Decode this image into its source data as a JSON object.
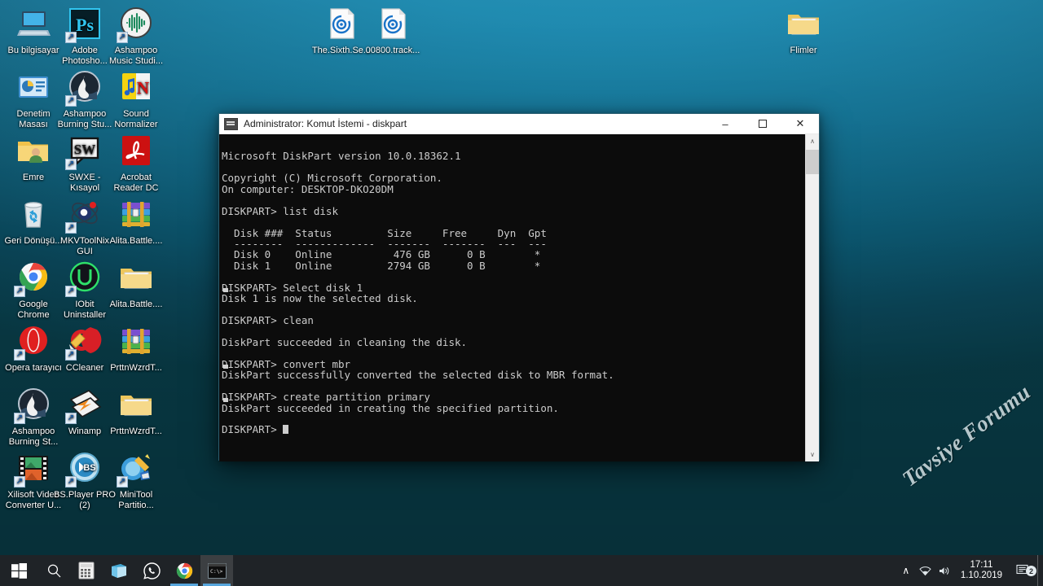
{
  "desktop": {
    "wallpaper_color_top": "#1b92b8",
    "wallpaper_color_bottom": "#083944",
    "watermark": "Tavsiye Forumu",
    "icons": [
      {
        "label": "Bu bilgisayar",
        "icon": "computer-icon",
        "shortcut": false,
        "col": 0,
        "row": 0
      },
      {
        "label": "Adobe Photosho...",
        "icon": "adobe-photoshop-icon",
        "shortcut": true,
        "col": 1,
        "row": 0
      },
      {
        "label": "Ashampoo Music Studi...",
        "icon": "ashampoo-music-studio-icon",
        "shortcut": true,
        "col": 2,
        "row": 0
      },
      {
        "label": "Denetim Masası",
        "icon": "control-panel-icon",
        "shortcut": false,
        "col": 0,
        "row": 1
      },
      {
        "label": "Ashampoo Burning Stu...",
        "icon": "ashampoo-burning-studio-icon",
        "shortcut": true,
        "col": 1,
        "row": 1
      },
      {
        "label": "Sound Normalizer",
        "icon": "sound-normalizer-icon",
        "shortcut": false,
        "col": 2,
        "row": 1
      },
      {
        "label": "Emre",
        "icon": "user-folder-icon",
        "shortcut": false,
        "col": 0,
        "row": 2
      },
      {
        "label": "SWXE - Kısayol",
        "icon": "swxe-icon",
        "shortcut": true,
        "col": 1,
        "row": 2
      },
      {
        "label": "Acrobat Reader DC",
        "icon": "acrobat-reader-icon",
        "shortcut": false,
        "col": 2,
        "row": 2
      },
      {
        "label": "Geri Dönüşü...",
        "icon": "recycle-bin-icon",
        "shortcut": false,
        "col": 0,
        "row": 3
      },
      {
        "label": "MKVToolNix GUI",
        "icon": "mkvtoolnix-icon",
        "shortcut": true,
        "col": 1,
        "row": 3
      },
      {
        "label": "Alita.Battle....",
        "icon": "winrar-archive-icon",
        "shortcut": false,
        "col": 2,
        "row": 3
      },
      {
        "label": "Google Chrome",
        "icon": "google-chrome-icon",
        "shortcut": true,
        "col": 0,
        "row": 4
      },
      {
        "label": "IObit Uninstaller",
        "icon": "iobit-uninstaller-icon",
        "shortcut": true,
        "col": 1,
        "row": 4
      },
      {
        "label": "Alita.Battle....",
        "icon": "folder-icon",
        "shortcut": false,
        "col": 2,
        "row": 4
      },
      {
        "label": "Opera tarayıcı",
        "icon": "opera-browser-icon",
        "shortcut": true,
        "col": 0,
        "row": 5
      },
      {
        "label": "CCleaner",
        "icon": "ccleaner-icon",
        "shortcut": true,
        "col": 1,
        "row": 5
      },
      {
        "label": "PrttnWzrdT...",
        "icon": "winrar-archive-icon",
        "shortcut": false,
        "col": 2,
        "row": 5
      },
      {
        "label": "Ashampoo Burning St...",
        "icon": "ashampoo-burning-studio-icon",
        "shortcut": true,
        "col": 0,
        "row": 6
      },
      {
        "label": "Winamp",
        "icon": "winamp-icon",
        "shortcut": true,
        "col": 1,
        "row": 6
      },
      {
        "label": "PrttnWzrdT...",
        "icon": "folder-icon",
        "shortcut": false,
        "col": 2,
        "row": 6
      },
      {
        "label": "Xilisoft Video Converter U...",
        "icon": "xilisoft-video-converter-icon",
        "shortcut": true,
        "col": 0,
        "row": 7
      },
      {
        "label": "BS.Player PRO (2)",
        "icon": "bsplayer-icon",
        "shortcut": true,
        "col": 1,
        "row": 7
      },
      {
        "label": "MiniTool Partitio...",
        "icon": "minitool-partition-icon",
        "shortcut": true,
        "col": 2,
        "row": 7
      },
      {
        "label": "The.Sixth.Se...",
        "icon": "disc-image-file-icon",
        "shortcut": false,
        "col": 6,
        "row": 0
      },
      {
        "label": "00800.track...",
        "icon": "disc-image-file-icon",
        "shortcut": false,
        "col": 7,
        "row": 0
      },
      {
        "label": "Flimler",
        "icon": "folder-icon",
        "shortcut": false,
        "col": 15,
        "row": 0
      }
    ]
  },
  "cmd_window": {
    "title": "Administrator: Komut İstemi - diskpart",
    "title_icon": "command-prompt-icon",
    "minimize_label": "–",
    "maximize_label": "☐",
    "close_label": "✕",
    "scroll_up_label": "∧",
    "scroll_down_label": "∨",
    "terminal_lines": [
      "",
      "Microsoft DiskPart version 10.0.18362.1",
      "",
      "Copyright (C) Microsoft Corporation.",
      "On computer: DESKTOP-DKO20DM",
      "",
      "DISKPART> list disk",
      "",
      "  Disk ###  Status         Size     Free     Dyn  Gpt",
      "  --------  -------------  -------  -------  ---  ---",
      "  Disk 0    Online          476 GB      0 B        *",
      "  Disk 1    Online         2794 GB      0 B        *",
      "",
      "DISKPART> Select disk 1",
      "@Disk 1 is now the selected disk.",
      "",
      "DISKPART> clean",
      "",
      "DiskPart succeeded in cleaning the disk.",
      "",
      "DISKPART> convert mbr",
      "@DiskPart successfully converted the selected disk to MBR format.",
      "",
      "DISKPART> create partition primary",
      "@DiskPart succeeded in creating the specified partition.",
      "",
      "DISKPART> #"
    ]
  },
  "taskbar": {
    "items": [
      {
        "name": "start-button",
        "icon": "windows-logo-icon",
        "active": false,
        "running": false
      },
      {
        "name": "search-button",
        "icon": "search-icon",
        "active": false,
        "running": false
      },
      {
        "name": "calculator-button",
        "icon": "calculator-icon",
        "active": false,
        "running": false
      },
      {
        "name": "sticky-notes-button",
        "icon": "sticky-notes-icon",
        "active": false,
        "running": false
      },
      {
        "name": "whatsapp-button",
        "icon": "whatsapp-icon",
        "active": false,
        "running": false
      },
      {
        "name": "chrome-button",
        "icon": "google-chrome-icon",
        "active": false,
        "running": true
      },
      {
        "name": "command-prompt-button",
        "icon": "command-prompt-icon",
        "active": true,
        "running": true
      }
    ],
    "tray": {
      "chevron_label": "∧",
      "wifi_icon": "wifi-icon",
      "volume_icon": "volume-icon",
      "time": "17:11",
      "date": "1.10.2019",
      "notification_icon": "action-center-icon",
      "notification_count": "2"
    }
  }
}
